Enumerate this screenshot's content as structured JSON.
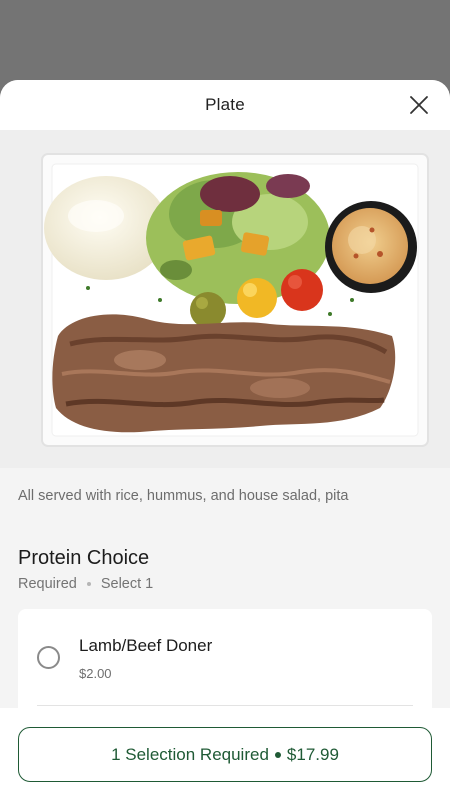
{
  "modal": {
    "title": "Plate"
  },
  "item": {
    "description": "All served with rice, hummus, and house salad, pita"
  },
  "protein_section": {
    "title": "Protein Choice",
    "required_label": "Required",
    "select_label": "Select 1",
    "options": [
      {
        "name": "Lamb/Beef Doner",
        "price": "$2.00",
        "selected": false
      }
    ]
  },
  "footer": {
    "cta_status": "1 Selection Required",
    "cta_price": "$17.99"
  },
  "colors": {
    "brand_green": "#1f5a35",
    "backdrop": "#747474"
  },
  "icons": {
    "close": "close-icon",
    "radio": "radio-unchecked-icon"
  }
}
